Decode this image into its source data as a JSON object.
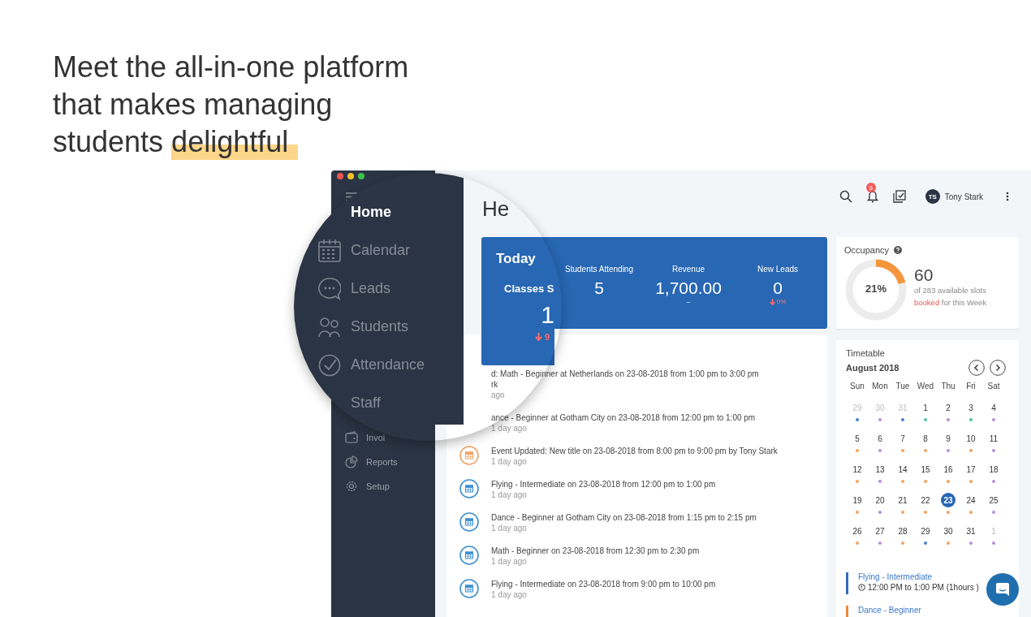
{
  "headline": {
    "lines": [
      "Meet the all-in-one platform",
      "that makes managing",
      "students"
    ],
    "highlight": "delightful"
  },
  "magnifier": {
    "items": [
      {
        "label": "Home",
        "selected": true
      },
      {
        "label": "Calendar",
        "selected": false
      },
      {
        "label": "Leads",
        "selected": false
      },
      {
        "label": "Students",
        "selected": false
      },
      {
        "label": "Attendance",
        "selected": false
      },
      {
        "label": "Staff",
        "selected": false
      }
    ]
  },
  "sidebar": {
    "items": [
      {
        "label": "Invoi"
      },
      {
        "label": "Reports"
      },
      {
        "label": "Setup"
      }
    ]
  },
  "topbar": {
    "notifications": "6",
    "avatar": "TS",
    "user": "Tony Stark"
  },
  "heading": "He",
  "today": {
    "title": "Today",
    "classes_label": "Classes S",
    "classes_value": "1",
    "classes_change": "9",
    "stats": [
      {
        "label": "Students Attending",
        "value": "5"
      },
      {
        "label": "Revenue",
        "value": "1,700.00",
        "note": "–"
      },
      {
        "label": "New Leads",
        "value": "0",
        "change": "0%"
      }
    ]
  },
  "occupancy": {
    "title": "Occupancy",
    "level": 0.21,
    "percent": "21%",
    "count": "60",
    "text_before": "of 283 available slots",
    "highlight": "booked",
    "text_after": "for this Week"
  },
  "activity": [
    {
      "lines": [
        "d: Math - Beginner at Netherlands on 23-08-2018 from 1:00 pm to 3:00 pm",
        "rk"
      ],
      "time": "ago"
    },
    {
      "lines": [
        "ance - Beginner at Gotham City on 23-08-2018 from 12:00 pm to 1:00 pm"
      ],
      "time": "1 day ago"
    },
    {
      "lines": [
        "Event Updated: New title on 23-08-2018 from 8:00 pm to 9:00 pm by Tony Stark"
      ],
      "time": "1 day ago",
      "color": "#f2a263"
    },
    {
      "lines": [
        "Flying - Intermediate on 23-08-2018 from 12:00 pm to 1:00 pm"
      ],
      "time": "1 day ago",
      "color": "#3d8fd1"
    },
    {
      "lines": [
        "Dance - Beginner at Gotham City on 23-08-2018 from 1:15 pm to 2:15 pm"
      ],
      "time": "1 day ago",
      "color": "#3d8fd1"
    },
    {
      "lines": [
        "Math - Beginner on 23-08-2018 from 12:30 pm to 2:30 pm"
      ],
      "time": "1 day ago",
      "color": "#3d8fd1"
    },
    {
      "lines": [
        "Flying - Intermediate on 23-08-2018 from 9:00 pm to 10:00 pm"
      ],
      "time": "1 day ago",
      "color": "#3d8fd1"
    }
  ],
  "timetable": {
    "title": "Timetable",
    "month": "August 2018",
    "weekdays": [
      "Sun",
      "Mon",
      "Tue",
      "Wed",
      "Thu",
      "Fri",
      "Sat"
    ],
    "weeks": [
      [
        {
          "day": "29",
          "muted": true,
          "selected": false,
          "color": "#4a7fd4"
        },
        {
          "day": "30",
          "muted": true,
          "selected": false,
          "color": "#b48fd8"
        },
        {
          "day": "31",
          "muted": true,
          "selected": false,
          "color": "#4a7fd4"
        },
        {
          "day": "1",
          "muted": false,
          "selected": false,
          "color": "#4fc3a1"
        },
        {
          "day": "2",
          "muted": false,
          "selected": false,
          "color": "#b48fd8"
        },
        {
          "day": "3",
          "muted": false,
          "selected": false,
          "color": "#4fc3a1"
        },
        {
          "day": "4",
          "muted": false,
          "selected": false,
          "color": "#b48fd8"
        }
      ],
      [
        {
          "day": "5",
          "muted": false,
          "selected": false,
          "color": "#f5a25d"
        },
        {
          "day": "6",
          "muted": false,
          "selected": false,
          "color": "#b48fd8"
        },
        {
          "day": "7",
          "muted": false,
          "selected": false,
          "color": "#f5a25d"
        },
        {
          "day": "8",
          "muted": false,
          "selected": false,
          "color": "#f5a25d"
        },
        {
          "day": "9",
          "muted": false,
          "selected": false,
          "color": "#b48fd8"
        },
        {
          "day": "10",
          "muted": false,
          "selected": false,
          "color": "#f5a25d"
        },
        {
          "day": "11",
          "muted": false,
          "selected": false,
          "color": "#b48fd8"
        }
      ],
      [
        {
          "day": "12",
          "muted": false,
          "selected": false,
          "color": "#f5a25d"
        },
        {
          "day": "13",
          "muted": false,
          "selected": false,
          "color": "#b48fd8"
        },
        {
          "day": "14",
          "muted": false,
          "selected": false,
          "color": "#f5a25d"
        },
        {
          "day": "15",
          "muted": false,
          "selected": false,
          "color": "#f5a25d"
        },
        {
          "day": "16",
          "muted": false,
          "selected": false,
          "color": "#f5a25d"
        },
        {
          "day": "17",
          "muted": false,
          "selected": false,
          "color": "#f5a25d"
        },
        {
          "day": "18",
          "muted": false,
          "selected": false,
          "color": "#b48fd8"
        }
      ],
      [
        {
          "day": "19",
          "muted": false,
          "selected": false,
          "color": "#f5a25d"
        },
        {
          "day": "20",
          "muted": false,
          "selected": false,
          "color": "#b48fd8"
        },
        {
          "day": "21",
          "muted": false,
          "selected": false,
          "color": "#f5a25d"
        },
        {
          "day": "22",
          "muted": false,
          "selected": false,
          "color": "#f5a25d"
        },
        {
          "day": "23",
          "muted": false,
          "selected": true,
          "color": "#f5a25d"
        },
        {
          "day": "24",
          "muted": false,
          "selected": false,
          "color": "#f5a25d"
        },
        {
          "day": "25",
          "muted": false,
          "selected": false,
          "color": "#b48fd8"
        }
      ],
      [
        {
          "day": "26",
          "muted": false,
          "selected": false,
          "color": "#f5a25d"
        },
        {
          "day": "27",
          "muted": false,
          "selected": false,
          "color": "#b48fd8"
        },
        {
          "day": "28",
          "muted": false,
          "selected": false,
          "color": "#f5a25d"
        },
        {
          "day": "29",
          "muted": false,
          "selected": false,
          "color": "#4a7fd4"
        },
        {
          "day": "30",
          "muted": false,
          "selected": false,
          "color": "#f5a25d"
        },
        {
          "day": "31",
          "muted": false,
          "selected": false,
          "color": "#b48fd8"
        },
        {
          "day": "1",
          "muted": true,
          "selected": false,
          "color": "#b48fd8"
        }
      ]
    ],
    "events": [
      {
        "title": "Flying - Intermediate",
        "time": "12:00 PM to 1:00 PM (1hours )",
        "color": "#2f6cc0"
      },
      {
        "title": "Dance - Beginner",
        "color": "#f0873a"
      }
    ]
  }
}
